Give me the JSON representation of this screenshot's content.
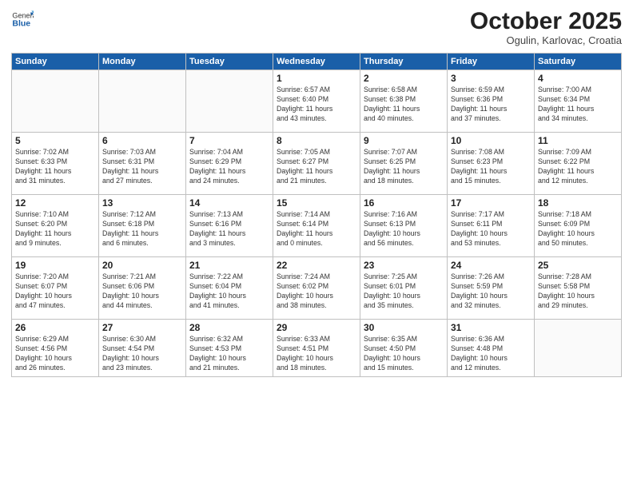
{
  "header": {
    "logo_general": "General",
    "logo_blue": "Blue",
    "title": "October 2025",
    "subtitle": "Ogulin, Karlovac, Croatia"
  },
  "weekdays": [
    "Sunday",
    "Monday",
    "Tuesday",
    "Wednesday",
    "Thursday",
    "Friday",
    "Saturday"
  ],
  "weeks": [
    [
      {
        "day": "",
        "info": ""
      },
      {
        "day": "",
        "info": ""
      },
      {
        "day": "",
        "info": ""
      },
      {
        "day": "1",
        "info": "Sunrise: 6:57 AM\nSunset: 6:40 PM\nDaylight: 11 hours\nand 43 minutes."
      },
      {
        "day": "2",
        "info": "Sunrise: 6:58 AM\nSunset: 6:38 PM\nDaylight: 11 hours\nand 40 minutes."
      },
      {
        "day": "3",
        "info": "Sunrise: 6:59 AM\nSunset: 6:36 PM\nDaylight: 11 hours\nand 37 minutes."
      },
      {
        "day": "4",
        "info": "Sunrise: 7:00 AM\nSunset: 6:34 PM\nDaylight: 11 hours\nand 34 minutes."
      }
    ],
    [
      {
        "day": "5",
        "info": "Sunrise: 7:02 AM\nSunset: 6:33 PM\nDaylight: 11 hours\nand 31 minutes."
      },
      {
        "day": "6",
        "info": "Sunrise: 7:03 AM\nSunset: 6:31 PM\nDaylight: 11 hours\nand 27 minutes."
      },
      {
        "day": "7",
        "info": "Sunrise: 7:04 AM\nSunset: 6:29 PM\nDaylight: 11 hours\nand 24 minutes."
      },
      {
        "day": "8",
        "info": "Sunrise: 7:05 AM\nSunset: 6:27 PM\nDaylight: 11 hours\nand 21 minutes."
      },
      {
        "day": "9",
        "info": "Sunrise: 7:07 AM\nSunset: 6:25 PM\nDaylight: 11 hours\nand 18 minutes."
      },
      {
        "day": "10",
        "info": "Sunrise: 7:08 AM\nSunset: 6:23 PM\nDaylight: 11 hours\nand 15 minutes."
      },
      {
        "day": "11",
        "info": "Sunrise: 7:09 AM\nSunset: 6:22 PM\nDaylight: 11 hours\nand 12 minutes."
      }
    ],
    [
      {
        "day": "12",
        "info": "Sunrise: 7:10 AM\nSunset: 6:20 PM\nDaylight: 11 hours\nand 9 minutes."
      },
      {
        "day": "13",
        "info": "Sunrise: 7:12 AM\nSunset: 6:18 PM\nDaylight: 11 hours\nand 6 minutes."
      },
      {
        "day": "14",
        "info": "Sunrise: 7:13 AM\nSunset: 6:16 PM\nDaylight: 11 hours\nand 3 minutes."
      },
      {
        "day": "15",
        "info": "Sunrise: 7:14 AM\nSunset: 6:14 PM\nDaylight: 11 hours\nand 0 minutes."
      },
      {
        "day": "16",
        "info": "Sunrise: 7:16 AM\nSunset: 6:13 PM\nDaylight: 10 hours\nand 56 minutes."
      },
      {
        "day": "17",
        "info": "Sunrise: 7:17 AM\nSunset: 6:11 PM\nDaylight: 10 hours\nand 53 minutes."
      },
      {
        "day": "18",
        "info": "Sunrise: 7:18 AM\nSunset: 6:09 PM\nDaylight: 10 hours\nand 50 minutes."
      }
    ],
    [
      {
        "day": "19",
        "info": "Sunrise: 7:20 AM\nSunset: 6:07 PM\nDaylight: 10 hours\nand 47 minutes."
      },
      {
        "day": "20",
        "info": "Sunrise: 7:21 AM\nSunset: 6:06 PM\nDaylight: 10 hours\nand 44 minutes."
      },
      {
        "day": "21",
        "info": "Sunrise: 7:22 AM\nSunset: 6:04 PM\nDaylight: 10 hours\nand 41 minutes."
      },
      {
        "day": "22",
        "info": "Sunrise: 7:24 AM\nSunset: 6:02 PM\nDaylight: 10 hours\nand 38 minutes."
      },
      {
        "day": "23",
        "info": "Sunrise: 7:25 AM\nSunset: 6:01 PM\nDaylight: 10 hours\nand 35 minutes."
      },
      {
        "day": "24",
        "info": "Sunrise: 7:26 AM\nSunset: 5:59 PM\nDaylight: 10 hours\nand 32 minutes."
      },
      {
        "day": "25",
        "info": "Sunrise: 7:28 AM\nSunset: 5:58 PM\nDaylight: 10 hours\nand 29 minutes."
      }
    ],
    [
      {
        "day": "26",
        "info": "Sunrise: 6:29 AM\nSunset: 4:56 PM\nDaylight: 10 hours\nand 26 minutes."
      },
      {
        "day": "27",
        "info": "Sunrise: 6:30 AM\nSunset: 4:54 PM\nDaylight: 10 hours\nand 23 minutes."
      },
      {
        "day": "28",
        "info": "Sunrise: 6:32 AM\nSunset: 4:53 PM\nDaylight: 10 hours\nand 21 minutes."
      },
      {
        "day": "29",
        "info": "Sunrise: 6:33 AM\nSunset: 4:51 PM\nDaylight: 10 hours\nand 18 minutes."
      },
      {
        "day": "30",
        "info": "Sunrise: 6:35 AM\nSunset: 4:50 PM\nDaylight: 10 hours\nand 15 minutes."
      },
      {
        "day": "31",
        "info": "Sunrise: 6:36 AM\nSunset: 4:48 PM\nDaylight: 10 hours\nand 12 minutes."
      },
      {
        "day": "",
        "info": ""
      }
    ]
  ]
}
